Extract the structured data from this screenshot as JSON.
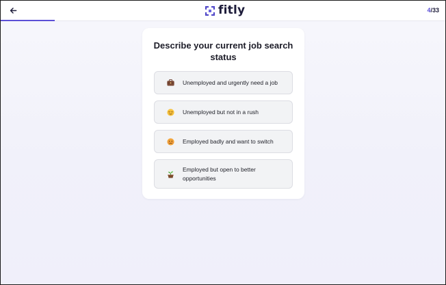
{
  "header": {
    "logo_text": "fitly",
    "progress": {
      "current": "4",
      "separator_total": "/33",
      "fraction": 0.121
    }
  },
  "question": {
    "title": "Describe your current job search status"
  },
  "options": [
    {
      "label": "Unemployed and urgently need a job",
      "icon": "briefcase-icon"
    },
    {
      "label": "Unemployed but not in a rush",
      "icon": "relieved-face-icon"
    },
    {
      "label": "Employed badly and want to switch",
      "icon": "unhappy-face-icon"
    },
    {
      "label": "Employed but open to better opportunities",
      "icon": "seedling-icon"
    }
  ],
  "colors": {
    "accent": "#5b4fd6",
    "text": "#1c1c28",
    "option_bg": "#f2f3f5"
  }
}
